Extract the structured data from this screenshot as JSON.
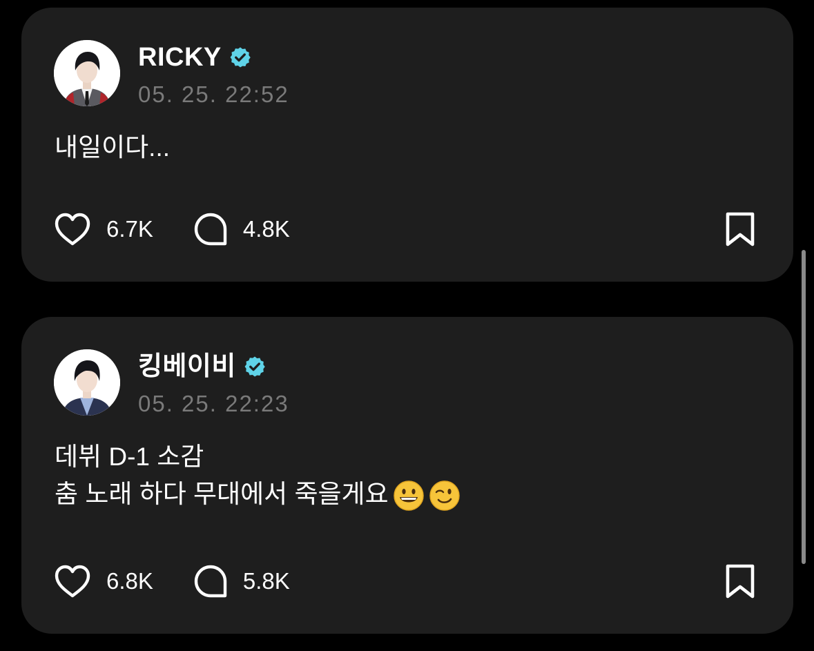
{
  "posts": [
    {
      "author": "RICKY",
      "verified": true,
      "timestamp": "05. 25. 22:52",
      "lines": [
        "내일이다..."
      ],
      "likes": "6.7K",
      "comments": "4.8K",
      "avatar_jacket_color": "#5a5a60",
      "avatar_accent_color": "#b0252b"
    },
    {
      "author": "킹베이비",
      "verified": true,
      "timestamp": "05. 25. 22:23",
      "lines": [
        "데뷔 D-1 소감",
        "춤 노래 하다 무대에서 죽을게요"
      ],
      "emojis": [
        "grinning-face",
        "winking-face"
      ],
      "likes": "6.8K",
      "comments": "5.8K",
      "avatar_jacket_color": "#2b3350",
      "avatar_accent_color": "#9fb4dc"
    }
  ],
  "icons": {
    "like": "heart-icon",
    "comment": "comment-bubble-icon",
    "bookmark": "bookmark-icon",
    "verified": "verified-badge-icon"
  },
  "colors": {
    "background": "#000000",
    "card": "#1e1e1e",
    "text": "#ffffff",
    "timestamp": "#7a7a7a",
    "verified_badge": "#5fd3e8",
    "scrollbar": "#8a8a8a"
  }
}
